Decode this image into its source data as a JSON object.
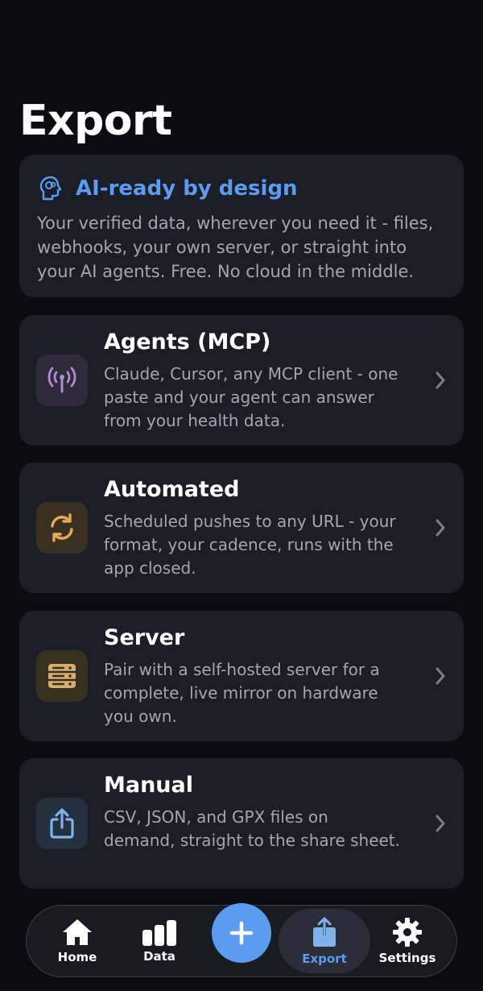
{
  "header": {
    "title": "Export"
  },
  "info": {
    "icon": "brain-head-icon",
    "title": "AI-ready by design",
    "body": "Your verified data, wherever you need it - files, webhooks, your own server, or straight into your AI agents. Free. No cloud in the middle."
  },
  "options": [
    {
      "icon": "antenna-icon",
      "title": "Agents (MCP)",
      "desc": "Claude, Cursor, any MCP client - one paste and your agent can answer from your health data.",
      "color": "#b48ad8"
    },
    {
      "icon": "sync-icon",
      "title": "Automated",
      "desc": "Scheduled pushes to any URL - your format, your cadence, runs with the app closed.",
      "color": "#e6a95a"
    },
    {
      "icon": "server-icon",
      "title": "Server",
      "desc": "Pair with a self-hosted server for a complete, live mirror on hardware you own.",
      "color": "#d6ae72"
    },
    {
      "icon": "share-icon",
      "title": "Manual",
      "desc": "CSV, JSON, and GPX files on demand, straight to the share sheet.",
      "color": "#7fb2ea"
    }
  ],
  "tabbar": {
    "home": "Home",
    "data": "Data",
    "add": "+",
    "export": "Export",
    "settings": "Settings",
    "active": "Export"
  },
  "colors": {
    "accent": "#5b9bf0",
    "background": "#0b0c12",
    "card": "#1c1e27"
  }
}
